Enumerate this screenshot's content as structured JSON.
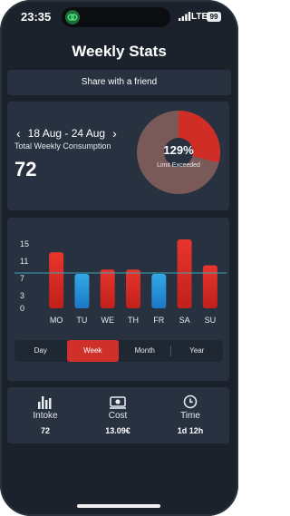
{
  "status_bar": {
    "time": "23:35",
    "network": "LTE",
    "battery": "99"
  },
  "title": "Weekly Stats",
  "share_label": "Share with a friend",
  "summary": {
    "prev_icon": "chevron-left-icon",
    "next_icon": "chevron-right-icon",
    "range": "18 Aug - 24 Aug",
    "label": "Total Weekly Consumption",
    "total": "72",
    "gauge_percent": "129%",
    "gauge_value": 1.29,
    "gauge_label": "Limit Exceeded",
    "colors": {
      "used": "#cf2d26",
      "rest": "#7a5a58"
    }
  },
  "chart_data": {
    "type": "bar",
    "categories": [
      "MO",
      "TU",
      "WE",
      "TH",
      "FR",
      "SA",
      "SU"
    ],
    "values": [
      13,
      8,
      9,
      9,
      8,
      16,
      10
    ],
    "ylim": [
      0,
      16
    ],
    "yticks": [
      0,
      3,
      7,
      11,
      15
    ],
    "limit_line": 8.2,
    "colors": {
      "over": "#e2322a",
      "under": "#2d9ad8",
      "limit": "#3aa6b8"
    }
  },
  "period_tabs": [
    {
      "label": "Day"
    },
    {
      "label": "Week"
    },
    {
      "label": "Month"
    },
    {
      "label": "Year"
    }
  ],
  "active_period": "Week",
  "stats": [
    {
      "icon": "bar-chart-icon",
      "label": "Intoke",
      "value": "72"
    },
    {
      "icon": "money-icon",
      "label": "Cost",
      "value": "13.09€"
    },
    {
      "icon": "clock-icon",
      "label": "Time",
      "value": "1d 12h"
    }
  ]
}
